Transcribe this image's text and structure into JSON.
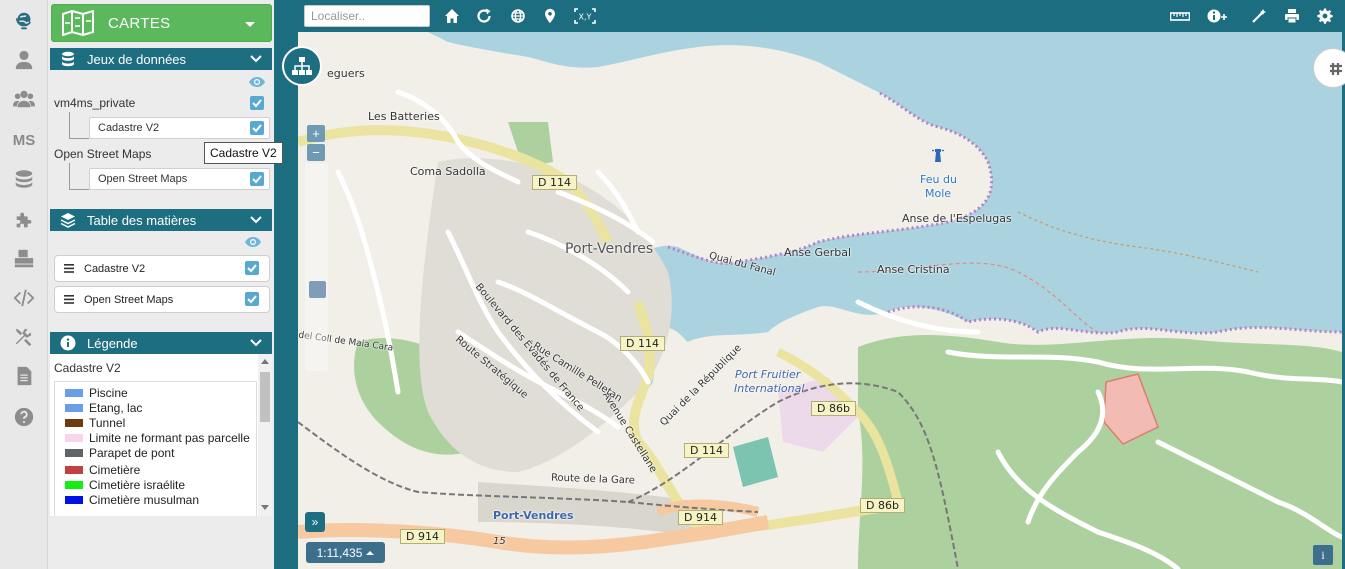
{
  "rail": {
    "items": [
      "globe-icon",
      "user-icon",
      "users-icon",
      "ms-text",
      "layers-icon",
      "puzzle-icon",
      "print-icon",
      "code-icon",
      "tools-icon",
      "document-icon",
      "help-icon"
    ],
    "ms_label": "MS"
  },
  "panel": {
    "cartes_label": "CARTES",
    "datasets": {
      "title": "Jeux de données",
      "groups": [
        {
          "name": "vm4ms_private",
          "layers": [
            "Cadastre V2"
          ]
        },
        {
          "name": "Open Street Maps",
          "layers": [
            "Open Street Maps"
          ]
        }
      ]
    },
    "toc": {
      "title": "Table des matières",
      "items": [
        "Cadastre V2",
        "Open Street Maps"
      ]
    },
    "tooltip": "Cadastre V2",
    "legend": {
      "title": "Légende",
      "layer": "Cadastre V2",
      "items": [
        {
          "label": "Piscine",
          "color": "#6a9ee8"
        },
        {
          "label": "Etang, lac",
          "color": "#6a9ee8"
        },
        {
          "label": "Tunnel",
          "color": "#6e3a0e"
        },
        {
          "label": "Limite ne formant pas parcelle",
          "color": "#fad4ec"
        },
        {
          "label": "Parapet de pont",
          "color": "#5f6468"
        },
        {
          "label": "Cimetière",
          "color": "#c24040"
        },
        {
          "label": "Cimetière israélite",
          "color": "#14ee10"
        },
        {
          "label": "Cimetière musulman",
          "color": "#0011e6"
        }
      ]
    }
  },
  "toolbar": {
    "search_placeholder": "Localiser..",
    "left_icons": [
      "home-icon",
      "refresh-icon",
      "globe-small-icon",
      "map-marker-icon",
      "xy-icon"
    ],
    "xy_label": "X,Y",
    "right_icons": [
      "ruler-icon",
      "info-plus-icon",
      "draw-icon",
      "print-icon",
      "settings-icon"
    ]
  },
  "map": {
    "zoom_in": "+",
    "zoom_out": "−",
    "scale": "1:11,435",
    "expand": "»",
    "info": "i",
    "labels": {
      "llegueurs": "eguers",
      "batteries": "Les Batteries",
      "coma": "Coma Sadolla",
      "port_vendres": "Port-Vendres",
      "quai_fanal": "Quai du Fanal",
      "anse_gerbal": "Anse Gerbal",
      "anse_cristina": "Anse Cristina",
      "feu_du": "Feu du",
      "mole": "Mole",
      "anse_espelugas": "Anse de l'Espelugas",
      "port_fruitier": "Port Fruitier",
      "international": "International",
      "route_gare": "Route de la Gare",
      "port_vendres_station": "Port-Vendres",
      "avenue_castellane": "Avenue Castellane",
      "rue_pelletan": "Rue Camille Pelletan",
      "bd_evades": "Boulevard des Évadés de France",
      "route_strategique": "Route Stratégique",
      "quai_republique": "Quai de la République",
      "col_maia": "del Coll de Maia Cara",
      "road_15": "15"
    },
    "roads": [
      "D 114",
      "D 114",
      "D 114",
      "D 86b",
      "D 86b",
      "D 914",
      "D 914"
    ]
  },
  "colors": {
    "accent": "#1e6e82",
    "green_button": "#5cb85c",
    "checkbox": "#57a9d2",
    "sea": "#aad3df",
    "land": "#f2efe9",
    "forest": "#add19e"
  }
}
